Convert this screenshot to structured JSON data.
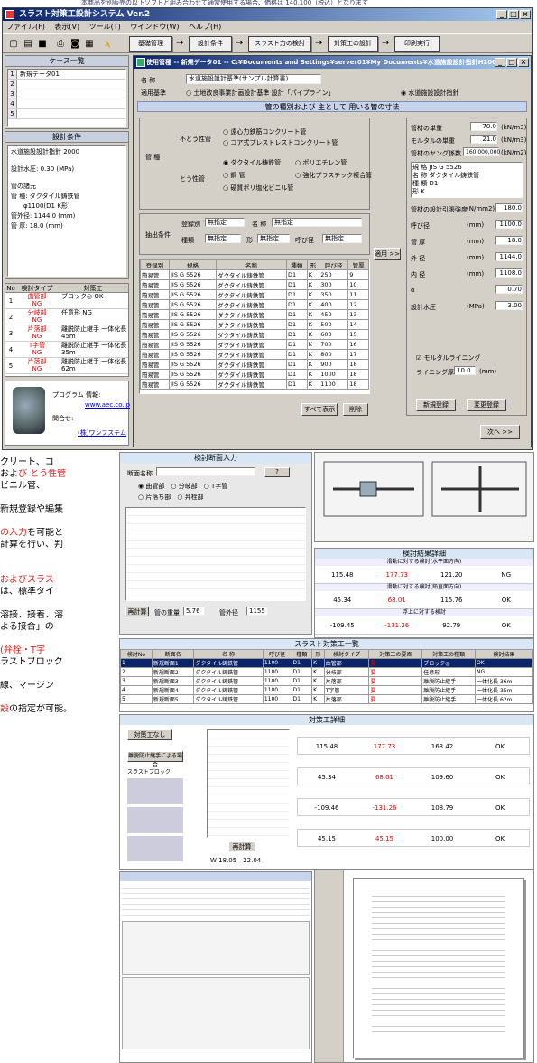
{
  "top_note": "本商品を別販売の以下ソフトと組み合わせて通常使用する場合、価格は 140,100（税込）となります",
  "app": {
    "title": "スラスト対策工設計システム Ver.2",
    "menu": [
      "ファイル(F)",
      "表示(V)",
      "ツール(T)",
      "ウインドウ(W)",
      "ヘルプ(H)"
    ],
    "flow": [
      "基礎管理",
      "設計条件",
      "スラスト力の検討",
      "対策工の設計",
      "印刷実行"
    ],
    "case_list": {
      "header": "ケース一覧",
      "items": [
        "新規データ01",
        "",
        "",
        "",
        ""
      ],
      "nums": [
        "1",
        "2",
        "3",
        "4",
        "5"
      ]
    },
    "design_cond": {
      "header": "設計条件",
      "std": "水道施設設計指針 2000",
      "pressure": "設計水圧: 0.30 (MPa)",
      "pipe_hdr": "管の諸元",
      "pipe_type": "管 種: ダクタイル鋳鉄管",
      "dia": "φ1100(D1 K形)",
      "od": "管外径: 1144.0 (mm)",
      "thick": "管 厚: 18.0 (mm)"
    },
    "parts": {
      "hdr_no": "No",
      "hdr_type": "検討タイプ",
      "hdr_work": "対策工",
      "rows": [
        {
          "no": "1",
          "type": "曲管部",
          "res": "NG",
          "work": "ブロック◎ OK"
        },
        {
          "no": "2",
          "type": "分岐部",
          "res": "NG",
          "work": "任意形 NG"
        },
        {
          "no": "3",
          "type": "片落部",
          "res": "NG",
          "work": "離脱防止継手 一体化長 45m"
        },
        {
          "no": "4",
          "type": "T字管",
          "res": "NG",
          "work": "離脱防止継手 一体化長 35m"
        },
        {
          "no": "5",
          "type": "片落部",
          "res": "NG",
          "work": "離脱防止継手 一体化長 62m"
        }
      ]
    },
    "info": {
      "prog": "プログラム 情報:",
      "url1": "www.aec.co.jp",
      "ask": "問合せ:",
      "url2": "(株)ワンフステム"
    }
  },
  "child": {
    "title": "使用管種 -- 新規データ01 -- C:¥Documents and Settings¥server01¥My Documents¥水道施設設計指針H2000¥.dat",
    "name_lbl": "名 称",
    "name_val": "水道施設設計基準(サンプル計算書)",
    "std_lbl": "適用基準",
    "std_opt1": "土地改良事業計画設計基準 設計「パイプライン」",
    "std_opt2": "水道施設設計指針",
    "band": "管の種別および 主として 用いる管の寸法",
    "pipe_lbl": "管 種",
    "rigid_lbl": "不とう性管",
    "rigid1": "遠心力鉄筋コンクリート管",
    "rigid2": "コア式プレストレストコンクリート管",
    "flex_lbl": "とう性管",
    "flex1": "ダクタイル鋳鉄管",
    "flex2": "ポリエチレン管",
    "flex3": "鋼 管",
    "flex4": "強化プラスチック複合管",
    "flex5": "硬質ポリ塩化ビニル管",
    "filter_lbl": "抽出条件",
    "reg_lbl": "登録別",
    "reg_val": "無指定",
    "name2_lbl": "名 称",
    "name2_val": "無指定",
    "kind_lbl": "種類",
    "kind_val": "無指定",
    "shape_lbl": "形",
    "shape_val": "無指定",
    "dia_lbl": "呼び径",
    "dia_val": "無指定",
    "table_hdr": [
      "登録別",
      "規格",
      "名称",
      "種類",
      "形",
      "呼び径",
      "管厚"
    ],
    "table_rows": [
      [
        "簡易管",
        "JIS G 5526",
        "ダクタイル鋳鉄管",
        "D1",
        "K",
        "250",
        "9"
      ],
      [
        "簡易管",
        "JIS G 5526",
        "ダクタイル鋳鉄管",
        "D1",
        "K",
        "300",
        "10"
      ],
      [
        "簡易管",
        "JIS G 5526",
        "ダクタイル鋳鉄管",
        "D1",
        "K",
        "350",
        "11"
      ],
      [
        "簡易管",
        "JIS G 5526",
        "ダクタイル鋳鉄管",
        "D1",
        "K",
        "400",
        "12"
      ],
      [
        "簡易管",
        "JIS G 5526",
        "ダクタイル鋳鉄管",
        "D1",
        "K",
        "450",
        "13"
      ],
      [
        "簡易管",
        "JIS G 5526",
        "ダクタイル鋳鉄管",
        "D1",
        "K",
        "500",
        "14"
      ],
      [
        "簡易管",
        "JIS G 5526",
        "ダクタイル鋳鉄管",
        "D1",
        "K",
        "600",
        "15"
      ],
      [
        "簡易管",
        "JIS G 5526",
        "ダクタイル鋳鉄管",
        "D1",
        "K",
        "700",
        "16"
      ],
      [
        "簡易管",
        "JIS G 5526",
        "ダクタイル鋳鉄管",
        "D1",
        "K",
        "800",
        "17"
      ],
      [
        "簡易管",
        "JIS G 5526",
        "ダクタイル鋳鉄管",
        "D1",
        "K",
        "900",
        "18"
      ],
      [
        "簡易管",
        "JIS G 5526",
        "ダクタイル鋳鉄管",
        "D1",
        "K",
        "1000",
        "18"
      ],
      [
        "簡易管",
        "JIS G 5526",
        "ダクタイル鋳鉄管",
        "D1",
        "K",
        "1100",
        "18"
      ]
    ],
    "apply_btn": "適用 >>",
    "right": {
      "unit1_lbl": "管材の単重",
      "unit1_val": "70.0",
      "unit1_u": "(kN/m3)",
      "unit2_lbl": "モルタルの単重",
      "unit2_val": "21.0",
      "unit2_u": "(kN/m3)",
      "young_lbl": "管材のヤング係数",
      "young_val": "160,000,000",
      "young_u": "(kN/m2)",
      "spec": "規 格 JIS G 5526",
      "nm": "名 称 ダクタイル鋳鉄管",
      "kd": "種 類 D1",
      "sh": "形 K",
      "rows": [
        [
          "管材の設計引張強度",
          "(N/mm2)",
          "180.0"
        ],
        [
          "呼び径",
          "(mm)",
          "1100.0"
        ],
        [
          "管 厚",
          "(mm)",
          "18.0"
        ],
        [
          "外 径",
          "(mm)",
          "1144.0"
        ],
        [
          "内 径",
          "(mm)",
          "1108.0"
        ],
        [
          "α",
          "",
          "0.70"
        ],
        [
          "設計水圧",
          "(MPa)",
          "3.00"
        ]
      ],
      "lining": "モルタルライニング",
      "lining_lbl": "ライニング厚",
      "lining_val": "10.0",
      "lining_u": "(mm)",
      "new_btn": "新規登録",
      "edit_btn": "変更登録"
    },
    "show_all": "すべて表示",
    "delete": "削除",
    "next": "次へ >>"
  },
  "desc": [
    {
      "pre": "クリート、コ",
      "hl": "",
      "post": ""
    },
    {
      "pre": "およ",
      "hl": "び とう性管",
      "post": ""
    },
    {
      "pre": "ビニル管、",
      "hl": "",
      "post": ""
    },
    {
      "pre": "",
      "hl": "",
      "post": ""
    },
    {
      "pre": "新規登録や編集",
      "hl": "",
      "post": ""
    },
    {
      "pre": "",
      "hl": "",
      "post": ""
    },
    {
      "pre": "",
      "hl": "の入力",
      "post": "を可能と"
    },
    {
      "pre": "計算を行い、判",
      "hl": "",
      "post": ""
    },
    {
      "pre": "",
      "hl": "",
      "post": ""
    },
    {
      "pre": "",
      "hl": "",
      "post": ""
    },
    {
      "pre": "",
      "hl": "およびスラス",
      "post": ""
    },
    {
      "pre": "は、標準タイ",
      "hl": "",
      "post": ""
    },
    {
      "pre": "",
      "hl": "",
      "post": ""
    },
    {
      "pre": "溶接、接着、溶",
      "hl": "",
      "post": ""
    },
    {
      "pre": "よる接合」の",
      "hl": "",
      "post": ""
    },
    {
      "pre": "",
      "hl": "",
      "post": ""
    },
    {
      "pre": "",
      "hl": "(弁栓・T字",
      "post": ""
    },
    {
      "pre": "ラストブロック",
      "hl": "",
      "post": ""
    },
    {
      "pre": "",
      "hl": "",
      "post": ""
    },
    {
      "pre": "線、マージン",
      "hl": "",
      "post": ""
    },
    {
      "pre": "",
      "hl": "",
      "post": ""
    },
    {
      "pre": "",
      "hl": "設",
      "post": "の指定が可能。"
    }
  ],
  "shots": {
    "input": {
      "title": "検討断面入力",
      "name": "断面名称",
      "opt": [
        "曲管部",
        "分岐部",
        "T字管",
        "片落ち部",
        "弁栓部"
      ],
      "calc_btn": "再計算",
      "dia_lbl": "管の重量",
      "dia_val": "5.76",
      "out_lbl": "管外径",
      "out_val": "1155",
      "unit": "(kN)"
    },
    "result": {
      "title": "検討結果詳細",
      "h1": "滑動に対する検討(水平面方向)",
      "h2": "滑動に対する検討(鉛直面方向)",
      "h3": "浮上に対する検討",
      "v": [
        [
          "115.48",
          "177.73",
          "121.20",
          "NG"
        ],
        [
          "45.34",
          "68.01",
          "115.76",
          "OK"
        ],
        [
          "-109.45",
          "-131.26",
          "92.79",
          "OK"
        ]
      ]
    },
    "list": {
      "title": "スラスト対策工一覧",
      "hdr": [
        "検討No",
        "断面名",
        "名 称",
        "呼び径",
        "種類",
        "形",
        "検討タイプ",
        "対策工の要否",
        "対策工の種類",
        "検討結果"
      ],
      "rows": [
        [
          "1",
          "新規断面1",
          "ダクタイル鋳鉄管",
          "1100",
          "D1",
          "K",
          "曲管部",
          "要",
          "ブロック◎",
          "OK"
        ],
        [
          "2",
          "新規断面2",
          "ダクタイル鋳鉄管",
          "1100",
          "D1",
          "K",
          "分岐部",
          "要",
          "任意形",
          "NG"
        ],
        [
          "3",
          "新規断面3",
          "ダクタイル鋳鉄管",
          "1100",
          "D1",
          "K",
          "片落部",
          "要",
          "離脱防止継手",
          "一体化長 36m"
        ],
        [
          "4",
          "新規断面4",
          "ダクタイル鋳鉄管",
          "1100",
          "D1",
          "K",
          "T字管",
          "要",
          "離脱防止継手",
          "一体化長 35m"
        ],
        [
          "5",
          "新規断面5",
          "ダクタイル鋳鉄管",
          "1100",
          "D1",
          "K",
          "片落部",
          "要",
          "離脱防止継手",
          "一体化長 62m"
        ]
      ]
    },
    "detail": {
      "title": "対策工詳細",
      "b1": "対策工なし",
      "b2": "離脱防止継手による場合",
      "b3": "スラストブロック",
      "calc": "再計算",
      "v": [
        [
          "115.48",
          "177.73",
          "163.42",
          "OK"
        ],
        [
          "45.34",
          "68.01",
          "109.60",
          "OK"
        ],
        [
          "-109.46",
          "-131.26",
          "108.79",
          "OK"
        ],
        [
          "45.15",
          "45.15",
          "100.00",
          "OK"
        ]
      ],
      "w1": "18.05",
      "w2": "22.04"
    }
  }
}
